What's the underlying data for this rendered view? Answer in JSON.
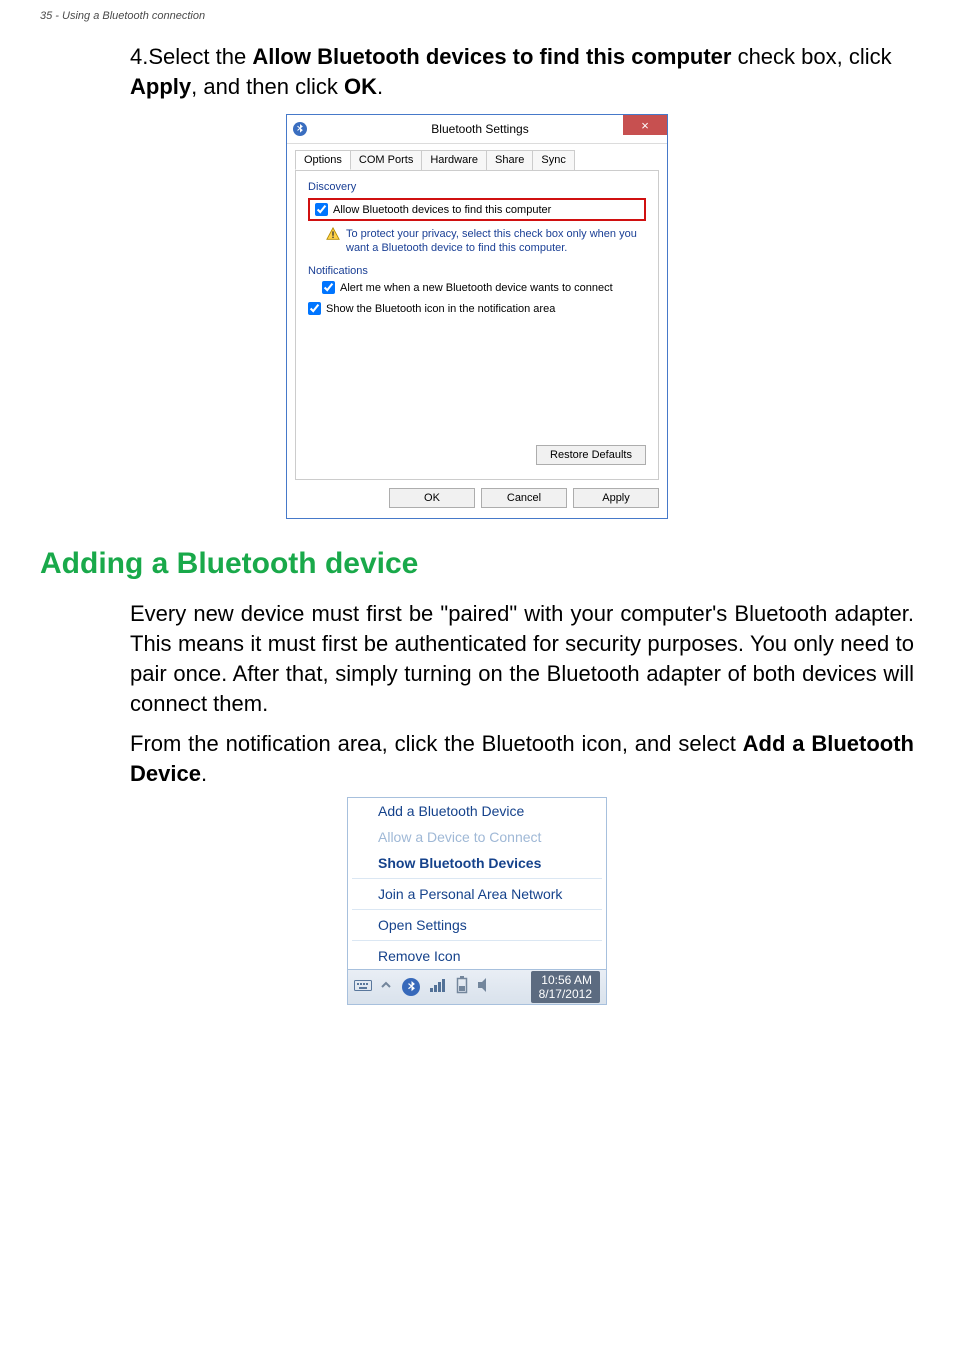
{
  "header": {
    "text": "35 - Using a Bluetooth connection"
  },
  "step": {
    "number": "4.",
    "pre": "Select the ",
    "bold1": "Allow Bluetooth devices to find this computer",
    "mid1": " check box, click ",
    "bold2": "Apply",
    "mid2": ", and then click ",
    "bold3": "OK",
    "end": "."
  },
  "dialog": {
    "title": "Bluetooth Settings",
    "close": "×",
    "tabs": {
      "options": "Options",
      "com_ports": "COM Ports",
      "hardware": "Hardware",
      "share": "Share",
      "sync": "Sync"
    },
    "groups": {
      "discovery": "Discovery",
      "notifications": "Notifications"
    },
    "allow_find": "Allow Bluetooth devices to find this computer",
    "privacy_note": "To protect your privacy, select this check box only when you want a Bluetooth device to find this computer.",
    "alert_new": "Alert me when a new Bluetooth device wants to connect",
    "show_icon": "Show the Bluetooth icon in the notification area",
    "restore_defaults": "Restore Defaults",
    "ok": "OK",
    "cancel": "Cancel",
    "apply": "Apply"
  },
  "section_heading": "Adding a Bluetooth device",
  "para1": "Every new device must first be \"paired\" with your computer's Bluetooth adapter. This means it must first be authenticated for security purposes. You only need to pair once. After that, simply turning on the Bluetooth adapter of both devices will connect them.",
  "para2_pre": "From the notification area, click the Bluetooth icon, and select ",
  "para2_bold": "Add a Bluetooth Device",
  "para2_end": ".",
  "tray": {
    "add_device": "Add a Bluetooth Device",
    "allow_connect": "Allow a Device to Connect",
    "show_devices": "Show Bluetooth Devices",
    "join_pan": "Join a Personal Area Network",
    "open_settings": "Open Settings",
    "remove_icon": "Remove Icon",
    "clock_time": "10:56 AM",
    "clock_date": "8/17/2012"
  }
}
